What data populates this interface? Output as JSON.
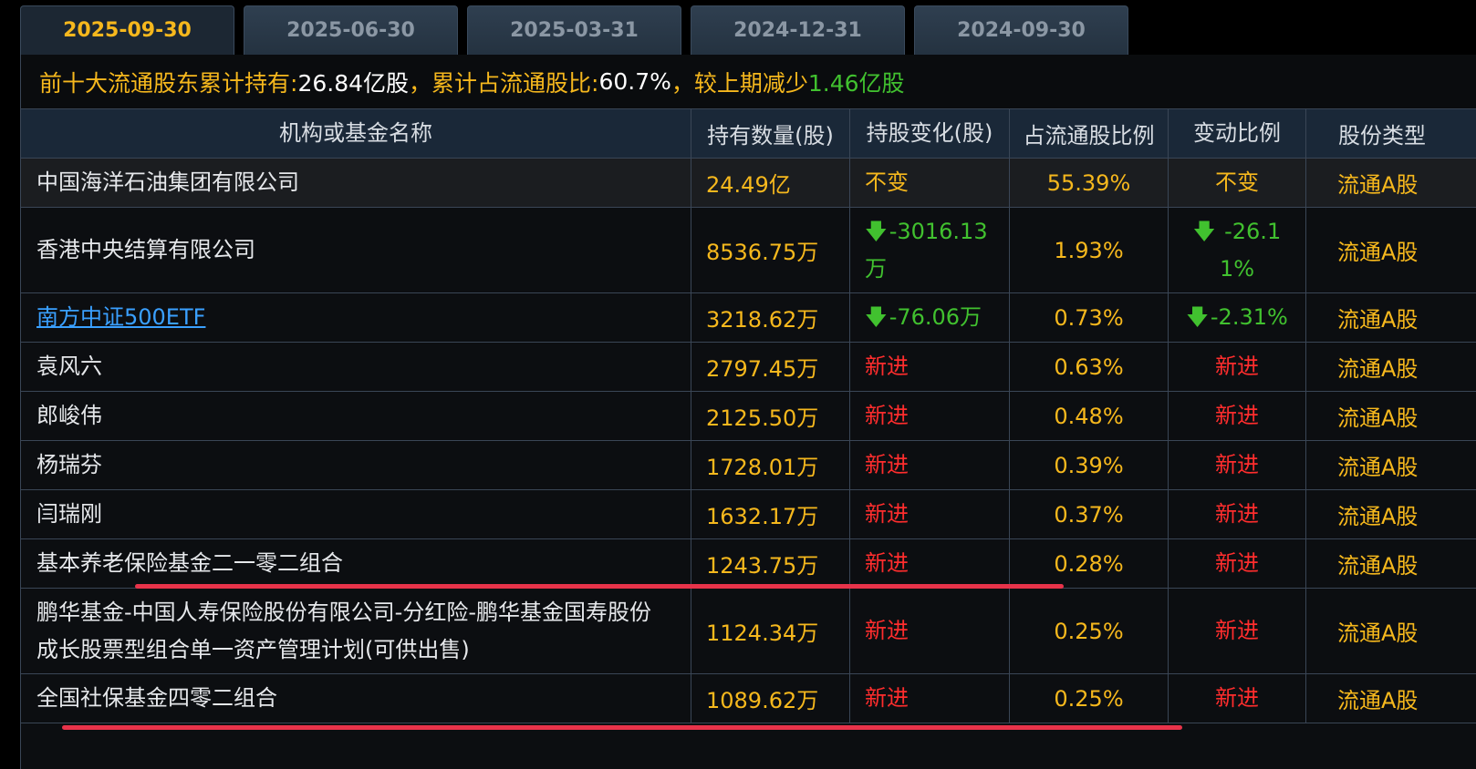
{
  "tabs": [
    {
      "label": "2025-09-30",
      "active": true
    },
    {
      "label": "2025-06-30",
      "active": false
    },
    {
      "label": "2025-03-31",
      "active": false
    },
    {
      "label": "2024-12-31",
      "active": false
    },
    {
      "label": "2024-09-30",
      "active": false
    }
  ],
  "summary": {
    "prefix": "前十大流通股东累计持有:",
    "holding": "26.84亿股",
    "ratio_label": "，累计占流通股比:",
    "ratio": "60.7%",
    "change_label": "，较上期减少",
    "change_value": "1.46亿股"
  },
  "table": {
    "headers": [
      "机构或基金名称",
      "持有数量(股)",
      "持股变化(股)",
      "占流通股比例",
      "变动比例",
      "股份类型"
    ],
    "rows": [
      {
        "name": "中国海洋石油集团有限公司",
        "shares": "24.49亿",
        "change": "不变",
        "ratio": "55.39%",
        "change_ratio": "不变",
        "type": "流通A股"
      },
      {
        "name": "香港中央结算有限公司",
        "shares": "8536.75万",
        "change": "-3016.13万",
        "ratio": "1.93%",
        "change_ratio": "-26.11%",
        "type": "流通A股"
      },
      {
        "name": "南方中证500ETF",
        "shares": "3218.62万",
        "change": "-76.06万",
        "ratio": "0.73%",
        "change_ratio": "-2.31%",
        "type": "流通A股"
      },
      {
        "name": "袁风六",
        "shares": "2797.45万",
        "change": "新进",
        "ratio": "0.63%",
        "change_ratio": "新进",
        "type": "流通A股"
      },
      {
        "name": "郎峻伟",
        "shares": "2125.50万",
        "change": "新进",
        "ratio": "0.48%",
        "change_ratio": "新进",
        "type": "流通A股"
      },
      {
        "name": "杨瑞芬",
        "shares": "1728.01万",
        "change": "新进",
        "ratio": "0.39%",
        "change_ratio": "新进",
        "type": "流通A股"
      },
      {
        "name": "闫瑞刚",
        "shares": "1632.17万",
        "change": "新进",
        "ratio": "0.37%",
        "change_ratio": "新进",
        "type": "流通A股"
      },
      {
        "name": "基本养老保险基金二一零二组合",
        "shares": "1243.75万",
        "change": "新进",
        "ratio": "0.28%",
        "change_ratio": "新进",
        "type": "流通A股"
      },
      {
        "name": "鹏华基金-中国人寿保险股份有限公司-分红险-鹏华基金国寿股份成长股票型组合单一资产管理计划(可供出售)",
        "shares": "1124.34万",
        "change": "新进",
        "ratio": "0.25%",
        "change_ratio": "新进",
        "type": "流通A股"
      },
      {
        "name": "全国社保基金四零二组合",
        "shares": "1089.62万",
        "change": "新进",
        "ratio": "0.25%",
        "change_ratio": "新进",
        "type": "流通A股"
      }
    ]
  },
  "colors": {
    "accent": "#f6b81d",
    "down": "#41c12f",
    "new": "#ff2d2d",
    "link": "#3aa0ff",
    "highlight": "#e8334a"
  }
}
